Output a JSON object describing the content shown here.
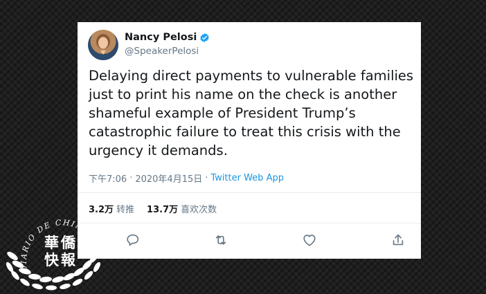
{
  "tweet": {
    "author_name": "Nancy Pelosi",
    "author_handle": "@SpeakerPelosi",
    "text": "Delaying direct payments to vulnerable families\njust to print his name on the check is another\nshameful example of President Trump’s\ncatastrophic failure to treat this crisis with the\nurgency it demands.",
    "time": "下午7:06",
    "date": "2020年4月15日",
    "separator": "·",
    "source": "Twitter Web App",
    "retweets_count": "3.2万",
    "retweets_label": "转推",
    "likes_count": "13.7万",
    "likes_label": "喜欢次数"
  },
  "watermark": {
    "chinese_line1": "華僑",
    "chinese_line2": "快報",
    "arc_text": "DIARIO DE CHINA"
  },
  "colors": {
    "link": "#1b95e0",
    "secondary_text": "#657786",
    "primary_text": "#14171a",
    "verified_badge": "#1da1f2"
  },
  "icons": [
    "verified-badge-icon",
    "reply-icon",
    "retweet-icon",
    "like-icon",
    "share-icon"
  ]
}
